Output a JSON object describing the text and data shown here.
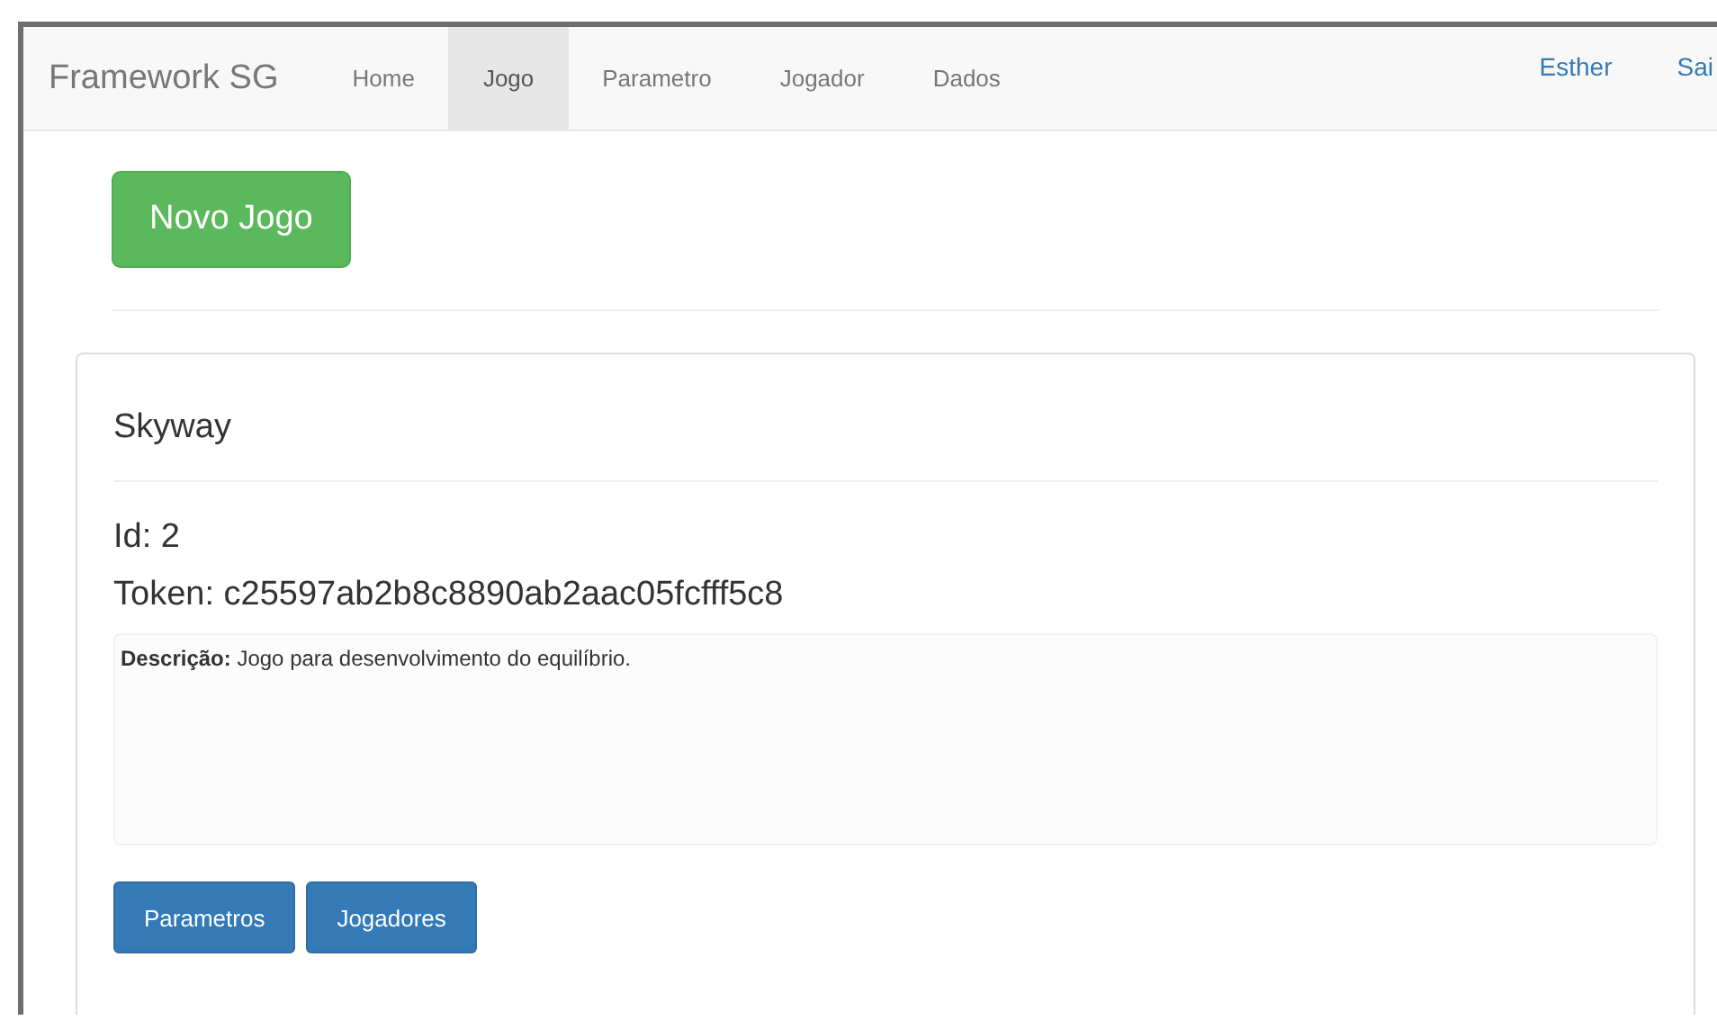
{
  "navbar": {
    "brand": "Framework SG",
    "items": [
      {
        "label": "Home",
        "selected": false
      },
      {
        "label": "Jogo",
        "selected": true
      },
      {
        "label": "Parametro",
        "selected": false
      },
      {
        "label": "Jogador",
        "selected": false
      },
      {
        "label": "Dados",
        "selected": false
      }
    ],
    "right_items": [
      "Esther",
      "Sai"
    ]
  },
  "new_button": "Novo Jogo",
  "card": {
    "title": "Skyway",
    "id": "Id: 2",
    "token": "Token: c25597ab2b8c8890ab2aac05fcfff5c8",
    "description": "**Descrição:** Jogo para desenvolvimento do equilíbrio.",
    "buttons": [
      "Parametros",
      "Jogadores"
    ]
  }
}
